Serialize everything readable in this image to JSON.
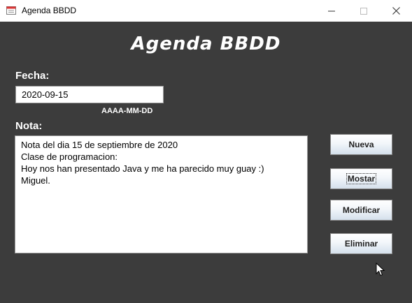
{
  "window": {
    "title": "Agenda BBDD",
    "icon": "calendar-icon"
  },
  "controls": {
    "minimize": "minimize-icon",
    "maximize": "maximize-icon",
    "close": "close-icon"
  },
  "app": {
    "heading": "Agenda BBDD"
  },
  "form": {
    "fecha_label": "Fecha:",
    "fecha_value": "2020-09-15",
    "fecha_hint": "AAAA-MM-DD",
    "nota_label": "Nota:",
    "nota_lines": [
      "Nota del dia 15 de septiembre de 2020",
      "Clase de programacion:",
      "Hoy nos han presentado Java y me ha parecido muy guay :)",
      "Miguel."
    ]
  },
  "buttons": {
    "nueva": "Nueva",
    "mostrar": "Mostar",
    "modificar": "Modificar",
    "eliminar": "Eliminar"
  },
  "colors": {
    "background": "#3c3c3c",
    "text": "#ffffff",
    "button_gradient_end": "#d4e0ec"
  }
}
